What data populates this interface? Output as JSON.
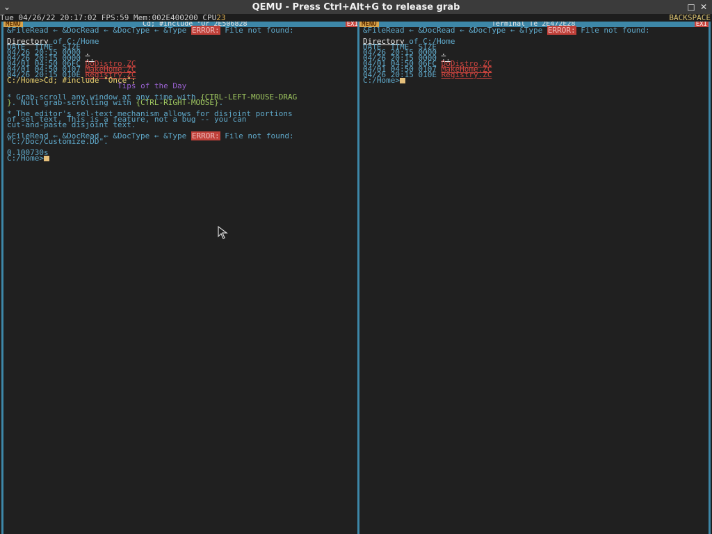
{
  "qemu": {
    "title": "QEMU - Press Ctrl+Alt+G to release grab",
    "menu_glyph": "⌄",
    "max_glyph": "□",
    "close_glyph": "✕"
  },
  "status": {
    "text": "Tue 04/26/22 20:17:02 FPS:59 Mem:002E400200 CPU",
    "cpu_value": "23",
    "backspace": "BACKSPACE"
  },
  "left": {
    "menu_label": "MENU",
    "title": "Cd; #include \"Or 2E506828",
    "close_label": "EXI",
    "lines": [
      {
        "parts": [
          {
            "t": "&FileRead ← &DocRead ← &DocType ← &Type "
          },
          {
            "t": "ERROR:",
            "c": "err"
          },
          {
            "t": " File not found:"
          }
        ]
      },
      {
        "parts": [
          {
            "t": ""
          }
        ]
      },
      {
        "parts": [
          {
            "t": "Directory",
            "c": "underline"
          },
          {
            "t": " of C:/Home"
          }
        ]
      },
      {
        "parts": [
          {
            "t": "DATE  TIME  SIZE"
          }
        ]
      },
      {
        "parts": [
          {
            "t": "04/26 20:15 0000 "
          },
          {
            "t": ".",
            "c": "underline"
          }
        ]
      },
      {
        "parts": [
          {
            "t": "04/26 20:15 0000 "
          },
          {
            "t": "..",
            "c": "underline"
          }
        ]
      },
      {
        "parts": [
          {
            "t": "04/01 04:50 06FC "
          },
          {
            "t": "DoDistro.ZC",
            "c": "link"
          }
        ]
      },
      {
        "parts": [
          {
            "t": "04/01 04:50 0107 "
          },
          {
            "t": "MakeHome.ZC",
            "c": "link"
          }
        ]
      },
      {
        "parts": [
          {
            "t": "04/26 20:15 010E "
          },
          {
            "t": "Registry.ZC",
            "c": "link"
          }
        ]
      },
      {
        "parts": [
          {
            "t": "C:/Home>Cd; #include \"Once\";",
            "c": "yellow"
          }
        ]
      },
      {
        "parts": [
          {
            "t": "                        "
          },
          {
            "t": "Tips of the Day",
            "c": "tips"
          }
        ]
      },
      {
        "parts": [
          {
            "t": ""
          }
        ]
      },
      {
        "parts": [
          {
            "t": "* Grab-scroll any window at any time with "
          },
          {
            "t": "{CTRL-LEFT-MOUSE-DRAG",
            "c": "green"
          }
        ]
      },
      {
        "parts": [
          {
            "t": "}",
            "c": "green"
          },
          {
            "t": ". Null grab-scrolling with "
          },
          {
            "t": "{CTRL-RIGHT-MOUSE}",
            "c": "green"
          },
          {
            "t": "."
          }
        ]
      },
      {
        "parts": [
          {
            "t": ""
          }
        ]
      },
      {
        "parts": [
          {
            "t": "* The editor's sel-text mechanism allows for disjoint portions"
          }
        ]
      },
      {
        "parts": [
          {
            "t": "of sel text. This is a feature, not a bug -- you can"
          }
        ]
      },
      {
        "parts": [
          {
            "t": "cut-and-paste disjoint text."
          }
        ]
      },
      {
        "parts": [
          {
            "t": ""
          }
        ]
      },
      {
        "parts": [
          {
            "t": "&FileRead ← &DocRead ← &DocType ← &Type "
          },
          {
            "t": "ERROR:",
            "c": "err"
          },
          {
            "t": " File not found:"
          }
        ]
      },
      {
        "parts": [
          {
            "t": "\"C:/Doc/Customize.DD\"."
          }
        ]
      },
      {
        "parts": [
          {
            "t": ""
          }
        ]
      },
      {
        "parts": [
          {
            "t": "0.100730s"
          }
        ]
      },
      {
        "parts": [
          {
            "t": "C:/Home>"
          }
        ],
        "cursor": true
      }
    ]
  },
  "right": {
    "menu_label": "MENU",
    "title": "Terminal Te 2E472E28",
    "close_label": "EXI",
    "lines": [
      {
        "parts": [
          {
            "t": "&FileRead ← &DocRead ← &DocType ← &Type "
          },
          {
            "t": "ERROR:",
            "c": "err"
          },
          {
            "t": " File not found:"
          }
        ]
      },
      {
        "parts": [
          {
            "t": ""
          }
        ]
      },
      {
        "parts": [
          {
            "t": "Directory",
            "c": "underline"
          },
          {
            "t": " of C:/Home"
          }
        ]
      },
      {
        "parts": [
          {
            "t": "DATE  TIME  SIZE"
          }
        ]
      },
      {
        "parts": [
          {
            "t": "04/26 20:15 0000 "
          },
          {
            "t": ".",
            "c": "underline"
          }
        ]
      },
      {
        "parts": [
          {
            "t": "04/26 20:15 0000 "
          },
          {
            "t": "..",
            "c": "underline"
          }
        ]
      },
      {
        "parts": [
          {
            "t": "04/01 04:50 06FC "
          },
          {
            "t": "DoDistro.ZC",
            "c": "link"
          }
        ]
      },
      {
        "parts": [
          {
            "t": "04/01 04:50 0107 "
          },
          {
            "t": "MakeHome.ZC",
            "c": "link"
          }
        ]
      },
      {
        "parts": [
          {
            "t": "04/26 20:15 010E "
          },
          {
            "t": "Registry.ZC",
            "c": "link"
          }
        ]
      },
      {
        "parts": [
          {
            "t": "C:/Home>"
          }
        ],
        "cursor": true
      }
    ]
  }
}
